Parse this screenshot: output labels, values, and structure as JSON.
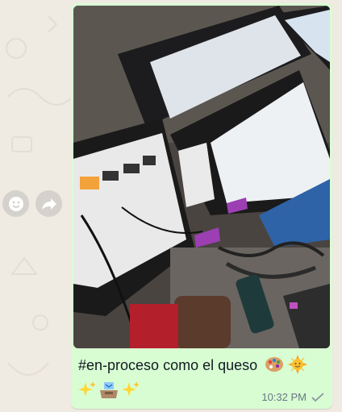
{
  "chat": {
    "message": {
      "caption_text": "#en-proceso como el queso",
      "time": "10:32 PM",
      "status": "delivered",
      "emojis": [
        "artist-palette-emoji",
        "sun-with-face-emoji",
        "sparkles-emoji",
        "inbox-tray-emoji",
        "sparkles-emoji"
      ]
    },
    "actions": {
      "react_icon": "smiley-icon",
      "forward_icon": "forward-icon"
    }
  },
  "colors": {
    "wallpaper": "#efeae2",
    "bubble_out": "#d9fdd3",
    "text": "#111b21",
    "meta": "#667781"
  }
}
